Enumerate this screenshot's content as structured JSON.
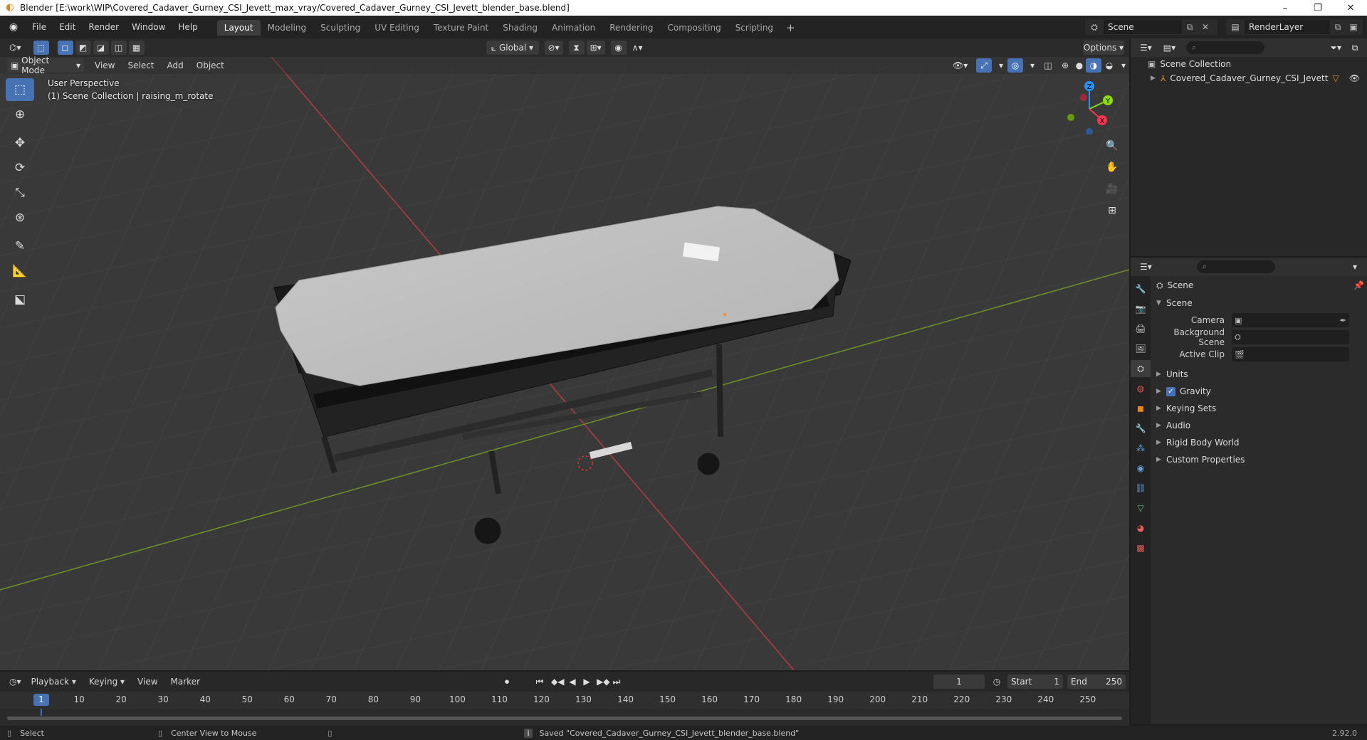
{
  "titlebar": {
    "title": "Blender [E:\\work\\WIP\\Covered_Cadaver_Gurney_CSI_Jevett_max_vray/Covered_Cadaver_Gurney_CSI_Jevett_blender_base.blend]",
    "minimize": "–",
    "restore": "❐",
    "close": "✕"
  },
  "menu": [
    "File",
    "Edit",
    "Render",
    "Window",
    "Help"
  ],
  "workspaces": [
    "Layout",
    "Modeling",
    "Sculpting",
    "UV Editing",
    "Texture Paint",
    "Shading",
    "Animation",
    "Rendering",
    "Compositing",
    "Scripting"
  ],
  "workspace_active": "Layout",
  "workspace_add": "+",
  "scene_selector": {
    "value": "Scene"
  },
  "renderlayer_selector": {
    "value": "RenderLayer"
  },
  "viewport": {
    "orientation": "Global",
    "options_label": "Options",
    "mode": "Object Mode",
    "menus": [
      "View",
      "Select",
      "Add",
      "Object"
    ],
    "perspective_text": "User Perspective",
    "collection_text": "(1) Scene Collection | raising_m_rotate",
    "gizmo_axes": [
      "Z",
      "Y",
      "X"
    ]
  },
  "outliner": {
    "scene_collection": "Scene Collection",
    "object_name": "Covered_Cadaver_Gurney_CSI_Jevett"
  },
  "properties": {
    "context_title": "Scene",
    "section_title": "Scene",
    "camera_label": "Camera",
    "background_scene_label": "Background Scene",
    "active_clip_label": "Active Clip",
    "subpanels": [
      "Units",
      "Gravity",
      "Keying Sets",
      "Audio",
      "Rigid Body World",
      "Custom Properties"
    ],
    "gravity_checked": true
  },
  "timeline": {
    "menus": [
      "Playback",
      "Keying",
      "View",
      "Marker"
    ],
    "current_frame": "1",
    "start_label": "Start",
    "start_value": "1",
    "end_label": "End",
    "end_value": "250",
    "ruler": [
      "1",
      "10",
      "20",
      "30",
      "40",
      "50",
      "60",
      "70",
      "80",
      "90",
      "100",
      "110",
      "120",
      "130",
      "140",
      "150",
      "160",
      "170",
      "180",
      "190",
      "200",
      "210",
      "220",
      "230",
      "240",
      "250"
    ]
  },
  "statusbar": {
    "select": "Select",
    "center_view": "Center View to Mouse",
    "message": "Saved \"Covered_Cadaver_Gurney_CSI_Jevett_blender_base.blend\"",
    "version": "2.92.0"
  },
  "colors": {
    "accent": "#4772b3",
    "x_axis": "#ff3352",
    "y_axis": "#8bdc00",
    "z_axis": "#2890ff"
  }
}
